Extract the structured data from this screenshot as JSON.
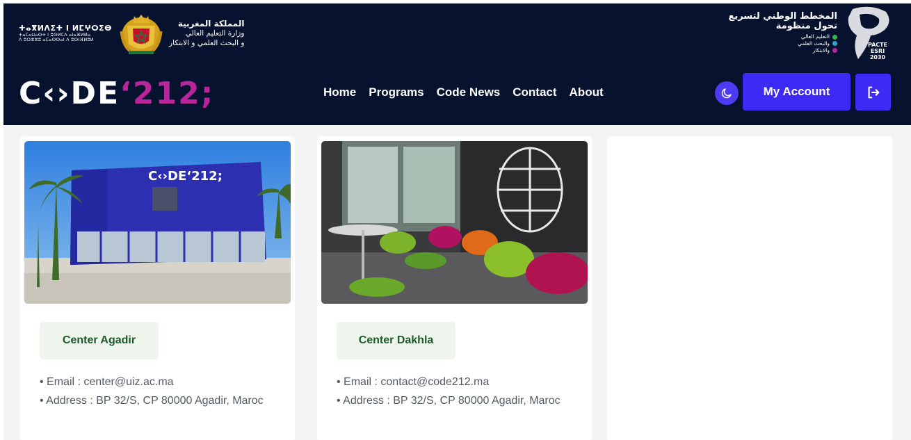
{
  "gov": {
    "tifinagh_line1": "ⵜⴰⴳⵍⴷⵉⵜ ⵏ ⵍⵎⵖⵔⵉⴱ",
    "tifinagh_line2": "ⵜⴰⵎⴰⵡⴰⵙⵜ ⵏ ⵓⵙⵍⵎⴷ ⴰⵏⴰⴼⵍⵍⴰ",
    "tifinagh_line3": "ⴷ ⵓⵔⵣⵣⵓ ⴰⵎⴰⵙⵙⴰⵏ ⴷ ⵓⵙⵏⴼⵍⵓⵍ",
    "arabic_line1": "المملكة المغربية",
    "arabic_line2": "وزارة التعليم العالي",
    "arabic_line3": "و البحث العلمي و الابتكار"
  },
  "pacte": {
    "title1": "المخطط الوطني لتسريع",
    "title2": "تحول منظومة",
    "items": [
      {
        "label": "التعليم العالي",
        "color": "#3fb34f"
      },
      {
        "label": "والبحث العلمي",
        "color": "#27a6d6"
      },
      {
        "label": "والابتكار",
        "color": "#b8249a"
      }
    ],
    "logo_line1": "PACTE",
    "logo_line2": "ESRI",
    "logo_line3": "2030"
  },
  "brand": {
    "logo_part1": "C‹›DE",
    "logo_part2": "‘212;"
  },
  "nav": {
    "items": [
      "Home",
      "Programs",
      "Code News",
      "Contact",
      "About"
    ]
  },
  "actions": {
    "account_label": "My Account"
  },
  "centers": [
    {
      "name": "Center Agadir",
      "email_line": "Email : center@uiz.ac.ma",
      "address_line": "Address : BP 32/S, CP 80000 Agadir, Maroc",
      "sign_text": "C‹›DE‘212;"
    },
    {
      "name": "Center Dakhla",
      "email_line": "Email : contact@code212.ma",
      "address_line": "Address : BP 32/S, CP 80000 Agadir, Maroc"
    }
  ]
}
